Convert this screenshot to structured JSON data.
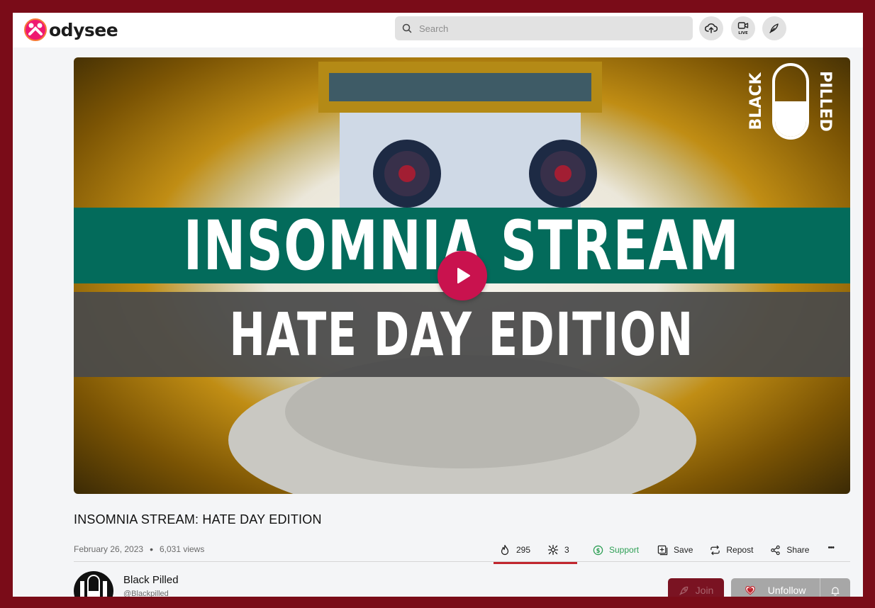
{
  "app": {
    "name": "odysee",
    "brand_color": "#ef1970"
  },
  "header": {
    "search_placeholder": "Search",
    "buttons": [
      {
        "icon": "upload-icon"
      },
      {
        "icon": "go-live-icon",
        "label": "LIVE"
      },
      {
        "icon": "feather-pen-icon"
      }
    ]
  },
  "video": {
    "thumbnail_title_line1": "INSOMNIA STREAM",
    "thumbnail_title_line2": "HATE DAY EDITION",
    "watermark_left": "BLACK",
    "watermark_right": "PILLED",
    "play_color": "#c9124e",
    "title": "INSOMNIA STREAM: HATE DAY EDITION",
    "date": "February 26, 2023",
    "views": "6,031 views"
  },
  "actions": {
    "fire_count": "295",
    "slime_count": "3",
    "support_label": "Support",
    "save_label": "Save",
    "repost_label": "Repost",
    "share_label": "Share",
    "more_label": "•••"
  },
  "channel": {
    "name": "Black Pilled",
    "handle": "@Blackpilled",
    "join_label": "Join",
    "unfollow_label": "Unfollow"
  }
}
